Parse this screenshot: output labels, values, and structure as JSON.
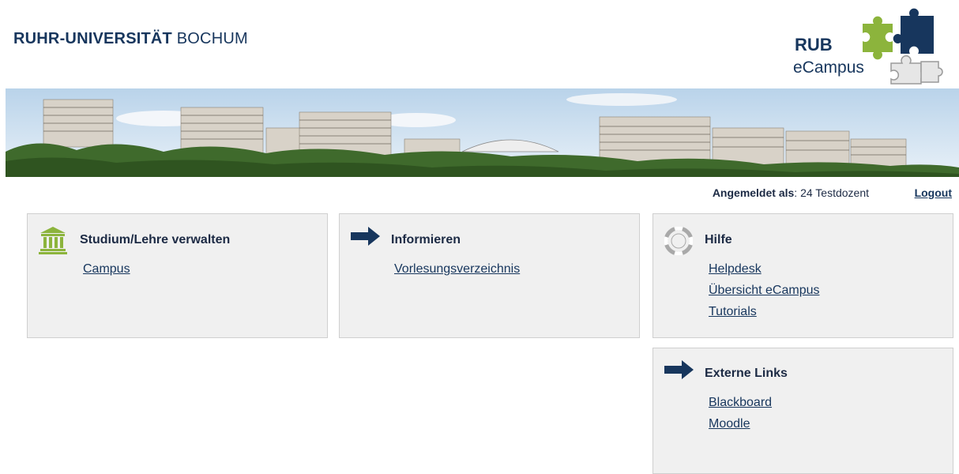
{
  "header": {
    "brand_bold": "RUHR-UNIVERSITÄT",
    "brand_light": "BOCHUM",
    "logo_rub": "RUB",
    "logo_ecampus": "eCampus"
  },
  "userbar": {
    "logged_in_label": "Angemeldet als",
    "logged_in_user": ": 24 Testdozent",
    "logout": "Logout"
  },
  "boxes": {
    "studium": {
      "title": "Studium/Lehre verwalten",
      "icon": "university-building-icon",
      "links": [
        "Campus"
      ]
    },
    "informieren": {
      "title": "Informieren",
      "icon": "arrow-right-icon",
      "links": [
        "Vorlesungsverzeichnis"
      ]
    },
    "hilfe": {
      "title": "Hilfe",
      "icon": "lifebuoy-icon",
      "links": [
        "Helpdesk",
        "Übersicht eCampus",
        "Tutorials"
      ]
    },
    "externe": {
      "title": "Externe Links",
      "icon": "arrow-right-icon",
      "links": [
        "Blackboard",
        "Moodle"
      ]
    }
  },
  "colors": {
    "navy": "#17365d",
    "green": "#8cb43c",
    "box_bg": "#f0f0f0"
  }
}
